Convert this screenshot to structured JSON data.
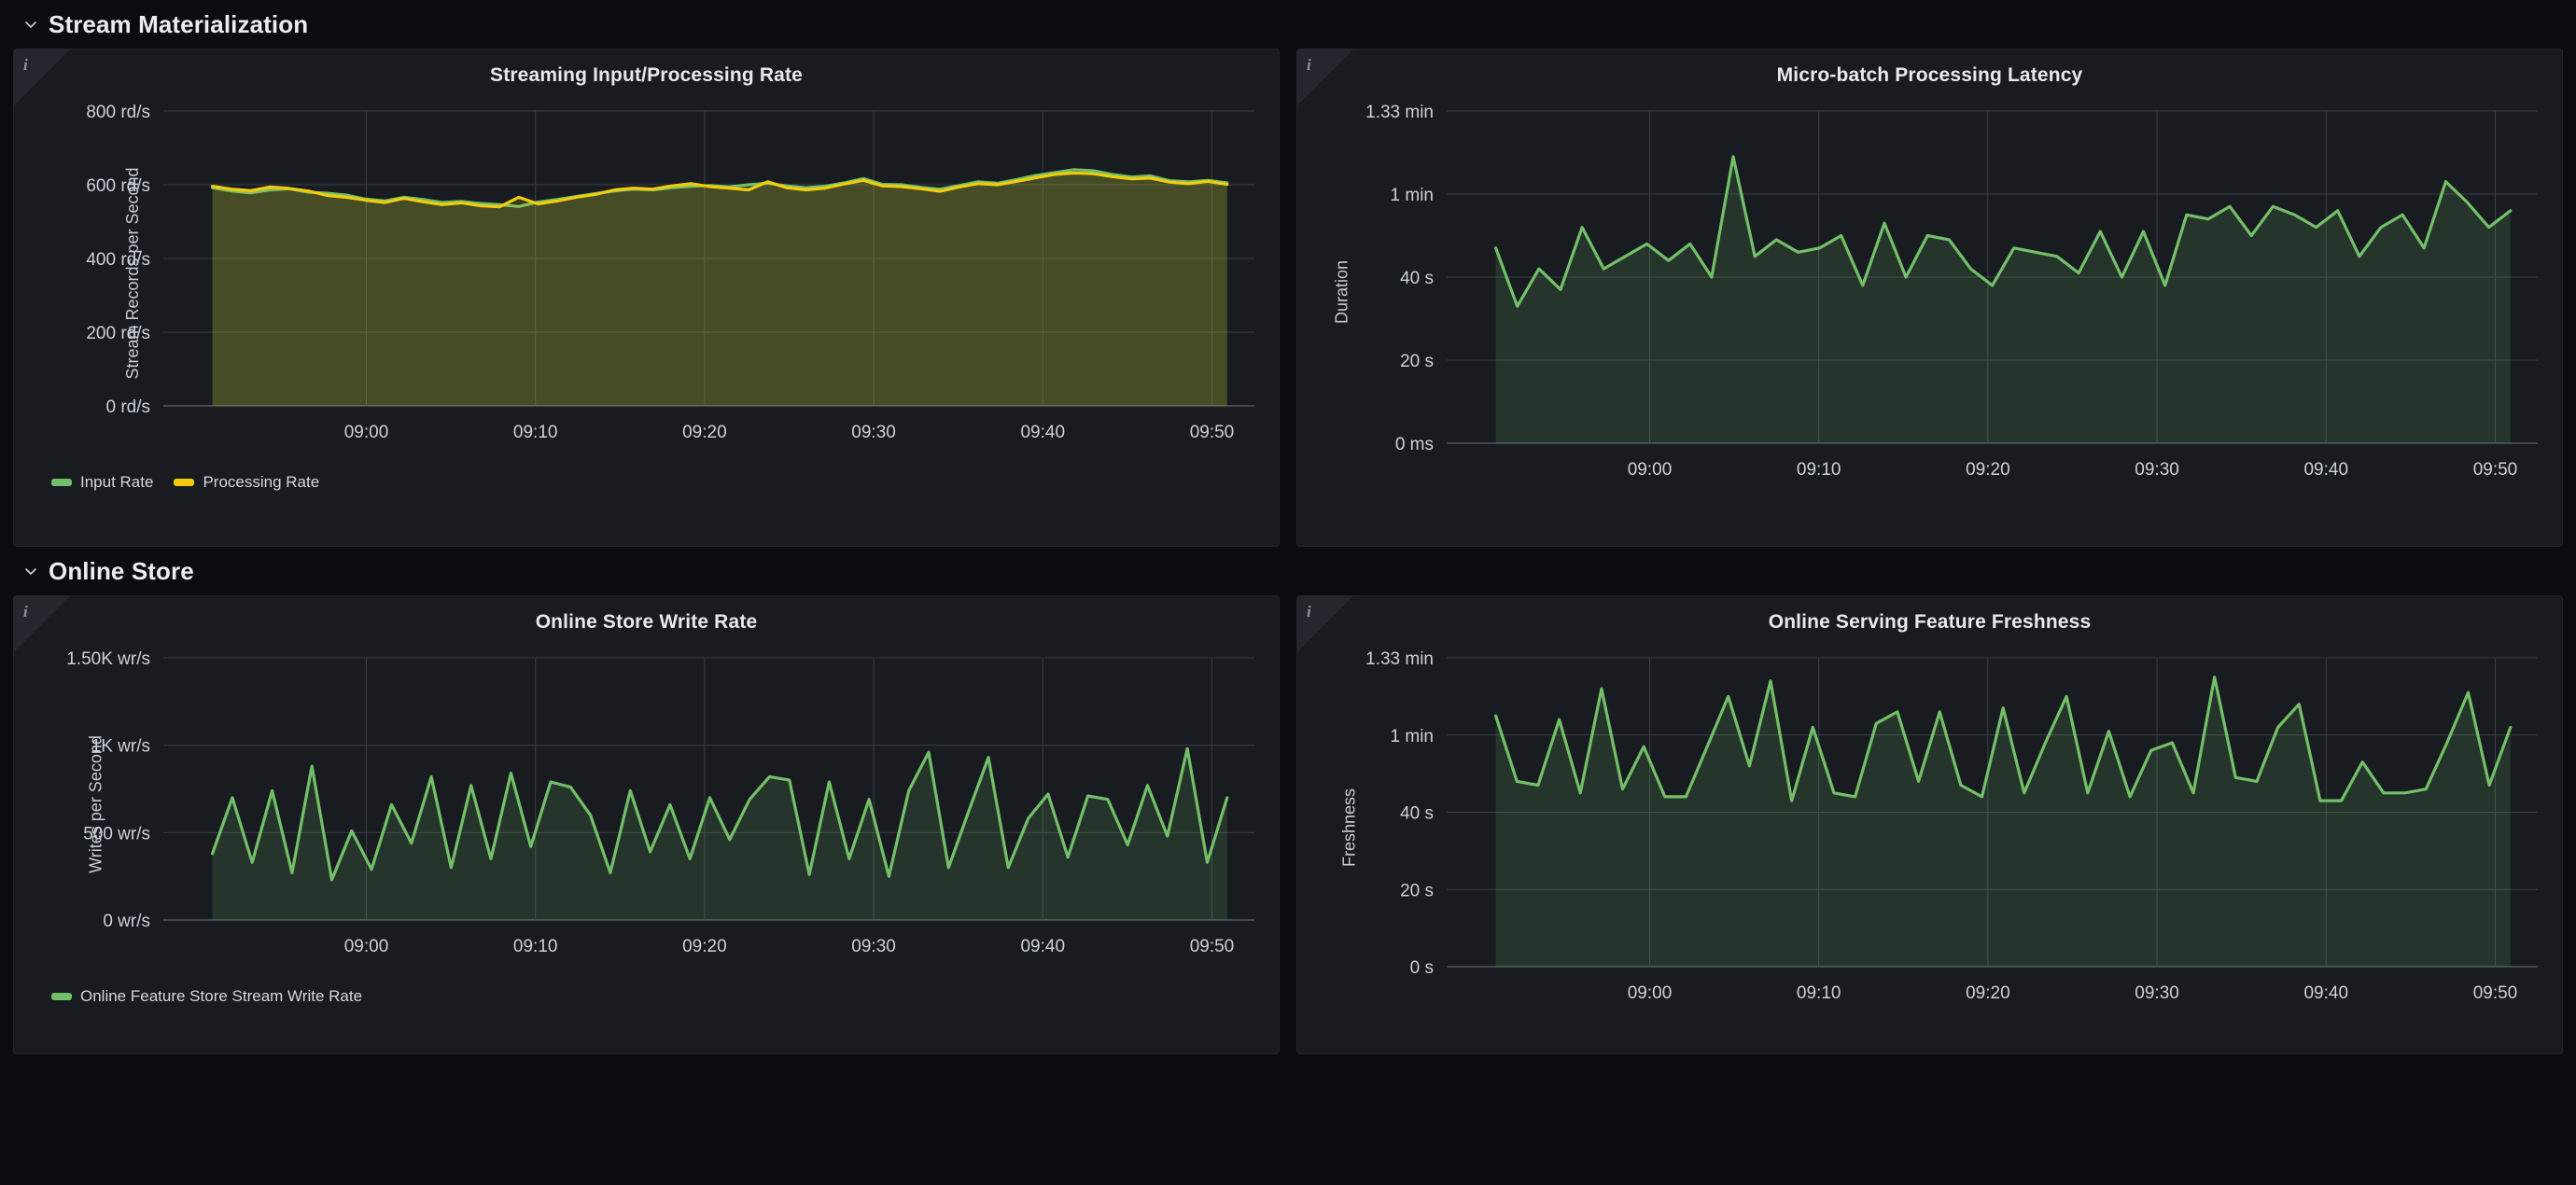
{
  "sections": [
    {
      "id": "stream-materialization",
      "title": "Stream Materialization",
      "chevron": "chevron-down-icon"
    },
    {
      "id": "online-store",
      "title": "Online Store",
      "chevron": "chevron-down-icon"
    }
  ],
  "panels": [
    {
      "id": "streaming-input-processing-rate",
      "title": "Streaming Input/Processing Rate",
      "info_icon": "info-icon",
      "y_title": "Stream Records per Second",
      "y_ticks": [
        "800 rd/s",
        "600 rd/s",
        "400 rd/s",
        "200 rd/s",
        "0 rd/s"
      ],
      "x_ticks": [
        "09:00",
        "09:10",
        "09:20",
        "09:30",
        "09:40",
        "09:50"
      ],
      "legend": [
        {
          "label": "Input Rate",
          "color": "#73bf69"
        },
        {
          "label": "Processing Rate",
          "color": "#f2cc0c"
        }
      ]
    },
    {
      "id": "micro-batch-processing-latency",
      "title": "Micro-batch Processing Latency",
      "info_icon": "info-icon",
      "y_title": "Duration",
      "y_ticks": [
        "1.33 min",
        "1 min",
        "40 s",
        "20 s",
        "0 ms"
      ],
      "x_ticks": [
        "09:00",
        "09:10",
        "09:20",
        "09:30",
        "09:40",
        "09:50"
      ],
      "legend": []
    },
    {
      "id": "online-store-write-rate",
      "title": "Online Store Write Rate",
      "info_icon": "info-icon",
      "y_title": "Writes per Second",
      "y_ticks": [
        "1.50K wr/s",
        "1K wr/s",
        "500 wr/s",
        "0 wr/s"
      ],
      "x_ticks": [
        "09:00",
        "09:10",
        "09:20",
        "09:30",
        "09:40",
        "09:50"
      ],
      "legend": [
        {
          "label": "Online Feature Store Stream Write Rate",
          "color": "#73bf69"
        }
      ]
    },
    {
      "id": "online-serving-feature-freshness",
      "title": "Online Serving Feature Freshness",
      "info_icon": "info-icon",
      "y_title": "Freshness",
      "y_ticks": [
        "1.33 min",
        "1 min",
        "40 s",
        "20 s",
        "0 s"
      ],
      "x_ticks": [
        "09:00",
        "09:10",
        "09:20",
        "09:30",
        "09:40",
        "09:50"
      ],
      "legend": []
    }
  ],
  "chart_data": [
    {
      "id": "streaming-input-processing-rate",
      "type": "area",
      "title": "Streaming Input/Processing Rate",
      "xlabel": "",
      "ylabel": "Stream Records per Second",
      "ylim": [
        0,
        800
      ],
      "yticks": [
        0,
        200,
        400,
        600,
        800
      ],
      "ytick_labels": [
        "0 rd/s",
        "200 rd/s",
        "400 rd/s",
        "600 rd/s",
        "800 rd/s"
      ],
      "xticks": [
        "09:00",
        "09:10",
        "09:20",
        "09:30",
        "09:40",
        "09:50"
      ],
      "grid": true,
      "legend_position": "bottom-left",
      "series": [
        {
          "name": "Input Rate",
          "color": "#73bf69",
          "values": [
            592,
            583,
            578,
            586,
            589,
            580,
            577,
            572,
            561,
            556,
            566,
            560,
            552,
            555,
            549,
            546,
            541,
            553,
            560,
            568,
            576,
            583,
            588,
            586,
            592,
            596,
            598,
            594,
            600,
            604,
            597,
            592,
            596,
            605,
            617,
            601,
            600,
            593,
            588,
            598,
            608,
            604,
            614,
            625,
            633,
            641,
            638,
            628,
            621,
            624,
            611,
            608,
            612,
            605
          ]
        },
        {
          "name": "Processing Rate",
          "color": "#f2cc0c",
          "values": [
            596,
            588,
            584,
            594,
            590,
            583,
            571,
            566,
            558,
            552,
            563,
            554,
            546,
            551,
            543,
            540,
            566,
            548,
            556,
            566,
            574,
            586,
            591,
            588,
            597,
            603,
            595,
            591,
            586,
            608,
            592,
            586,
            591,
            602,
            612,
            597,
            595,
            589,
            582,
            594,
            603,
            600,
            609,
            619,
            628,
            632,
            630,
            622,
            616,
            618,
            607,
            603,
            609,
            601
          ]
        }
      ]
    },
    {
      "id": "micro-batch-processing-latency",
      "type": "area",
      "title": "Micro-batch Processing Latency",
      "xlabel": "",
      "ylabel": "Duration",
      "ylim": [
        0,
        80
      ],
      "yticks": [
        0,
        20,
        40,
        60,
        80
      ],
      "ytick_labels": [
        "0 ms",
        "20 s",
        "40 s",
        "1 min",
        "1.33 min"
      ],
      "xticks": [
        "09:00",
        "09:10",
        "09:20",
        "09:30",
        "09:40",
        "09:50"
      ],
      "grid": true,
      "legend_position": "none",
      "series": [
        {
          "name": "Micro-batch Processing Latency",
          "color": "#73bf69",
          "values": [
            47,
            33,
            42,
            37,
            52,
            42,
            45,
            48,
            44,
            48,
            40,
            69,
            45,
            49,
            46,
            47,
            50,
            38,
            53,
            40,
            50,
            49,
            42,
            38,
            47,
            46,
            45,
            41,
            51,
            40,
            51,
            38,
            55,
            54,
            57,
            50,
            57,
            55,
            52,
            56,
            45,
            52,
            55,
            47,
            63,
            58,
            52,
            56
          ]
        }
      ]
    },
    {
      "id": "online-store-write-rate",
      "type": "area",
      "title": "Online Store Write Rate",
      "xlabel": "",
      "ylabel": "Writes per Second",
      "ylim": [
        0,
        1500
      ],
      "yticks": [
        0,
        500,
        1000,
        1500
      ],
      "ytick_labels": [
        "0 wr/s",
        "500 wr/s",
        "1K wr/s",
        "1.50K wr/s"
      ],
      "xticks": [
        "09:00",
        "09:10",
        "09:20",
        "09:30",
        "09:40",
        "09:50"
      ],
      "grid": true,
      "legend_position": "bottom-left",
      "series": [
        {
          "name": "Online Feature Store Stream Write Rate",
          "color": "#73bf69",
          "values": [
            380,
            700,
            330,
            740,
            270,
            880,
            230,
            510,
            290,
            660,
            440,
            820,
            300,
            770,
            350,
            840,
            420,
            790,
            760,
            600,
            270,
            740,
            390,
            660,
            350,
            700,
            460,
            690,
            820,
            800,
            260,
            790,
            350,
            690,
            250,
            740,
            960,
            300,
            620,
            930,
            300,
            580,
            720,
            360,
            710,
            690,
            430,
            770,
            480,
            980,
            330,
            700
          ]
        }
      ]
    },
    {
      "id": "online-serving-feature-freshness",
      "type": "area",
      "title": "Online Serving Feature Freshness",
      "xlabel": "",
      "ylabel": "Freshness",
      "ylim": [
        0,
        80
      ],
      "yticks": [
        0,
        20,
        40,
        60,
        80
      ],
      "ytick_labels": [
        "0 s",
        "20 s",
        "40 s",
        "1 min",
        "1.33 min"
      ],
      "xticks": [
        "09:00",
        "09:10",
        "09:20",
        "09:30",
        "09:40",
        "09:50"
      ],
      "grid": true,
      "legend_position": "none",
      "series": [
        {
          "name": "Online Serving Feature Freshness",
          "color": "#73bf69",
          "values": [
            65,
            48,
            47,
            64,
            45,
            72,
            46,
            57,
            44,
            44,
            57,
            70,
            52,
            74,
            43,
            62,
            45,
            44,
            63,
            66,
            48,
            66,
            47,
            44,
            67,
            45,
            58,
            70,
            45,
            61,
            44,
            56,
            58,
            45,
            75,
            49,
            48,
            62,
            68,
            43,
            43,
            53,
            45,
            45,
            46,
            58,
            71,
            47,
            62
          ]
        }
      ]
    }
  ]
}
